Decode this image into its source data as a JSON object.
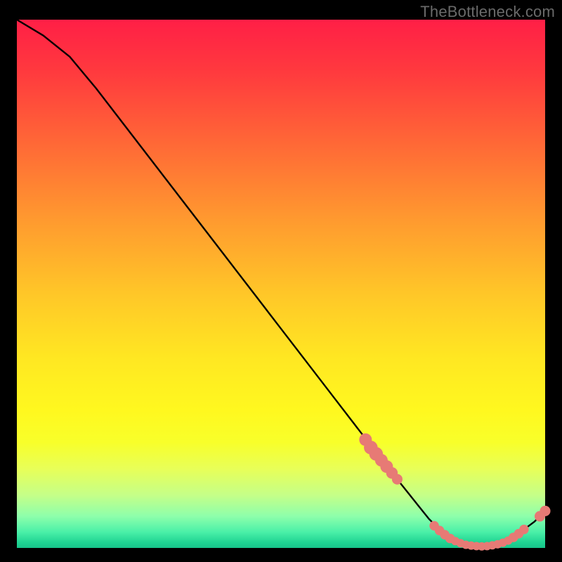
{
  "watermark": "TheBottleneck.com",
  "colors": {
    "background": "#000000",
    "curve": "#000000",
    "dot": "#e77a75",
    "gradient_top": "#ff1f46",
    "gradient_mid": "#ffe722",
    "gradient_bottom": "#18c48a"
  },
  "chart_data": {
    "type": "line",
    "title": "",
    "xlabel": "",
    "ylabel": "",
    "xlim": [
      0,
      100
    ],
    "ylim": [
      0,
      100
    ],
    "grid": false,
    "series": [
      {
        "name": "bottleneck-curve",
        "x": [
          0,
          5,
          10,
          15,
          20,
          25,
          30,
          35,
          40,
          45,
          50,
          55,
          60,
          65,
          70,
          72,
          74,
          76,
          78,
          80,
          82,
          84,
          86,
          88,
          90,
          92,
          94,
          96,
          98,
          100
        ],
        "values": [
          100,
          97,
          93,
          87,
          80.5,
          74,
          67.5,
          61,
          54.5,
          48,
          41.5,
          35,
          28.5,
          22,
          15.5,
          13,
          10.5,
          8,
          5.5,
          3.5,
          2,
          1,
          0.5,
          0.3,
          0.5,
          1,
          2,
          3.5,
          5,
          7
        ]
      }
    ],
    "scatter": [
      {
        "name": "highlighted-points",
        "points": [
          {
            "x": 66,
            "y": 20.5,
            "r": 1.2
          },
          {
            "x": 67,
            "y": 19,
            "r": 1.3
          },
          {
            "x": 68,
            "y": 17.8,
            "r": 1.3
          },
          {
            "x": 69,
            "y": 16.6,
            "r": 1.2
          },
          {
            "x": 70,
            "y": 15.4,
            "r": 1.2
          },
          {
            "x": 71,
            "y": 14.2,
            "r": 1.1
          },
          {
            "x": 72,
            "y": 13,
            "r": 1.0
          },
          {
            "x": 79,
            "y": 4.2,
            "r": 0.9
          },
          {
            "x": 80,
            "y": 3.3,
            "r": 0.9
          },
          {
            "x": 81,
            "y": 2.5,
            "r": 0.9
          },
          {
            "x": 82,
            "y": 1.8,
            "r": 0.9
          },
          {
            "x": 83,
            "y": 1.3,
            "r": 0.8
          },
          {
            "x": 84,
            "y": 0.9,
            "r": 0.8
          },
          {
            "x": 85,
            "y": 0.6,
            "r": 0.8
          },
          {
            "x": 86,
            "y": 0.45,
            "r": 0.8
          },
          {
            "x": 87,
            "y": 0.35,
            "r": 0.8
          },
          {
            "x": 88,
            "y": 0.3,
            "r": 0.8
          },
          {
            "x": 89,
            "y": 0.35,
            "r": 0.8
          },
          {
            "x": 90,
            "y": 0.5,
            "r": 0.8
          },
          {
            "x": 91,
            "y": 0.7,
            "r": 0.8
          },
          {
            "x": 92,
            "y": 1.0,
            "r": 0.8
          },
          {
            "x": 93,
            "y": 1.4,
            "r": 0.8
          },
          {
            "x": 94,
            "y": 2.0,
            "r": 0.9
          },
          {
            "x": 95,
            "y": 2.7,
            "r": 0.9
          },
          {
            "x": 96,
            "y": 3.5,
            "r": 0.9
          },
          {
            "x": 99,
            "y": 6.0,
            "r": 1.0
          },
          {
            "x": 100,
            "y": 7.0,
            "r": 1.0
          }
        ]
      }
    ]
  }
}
